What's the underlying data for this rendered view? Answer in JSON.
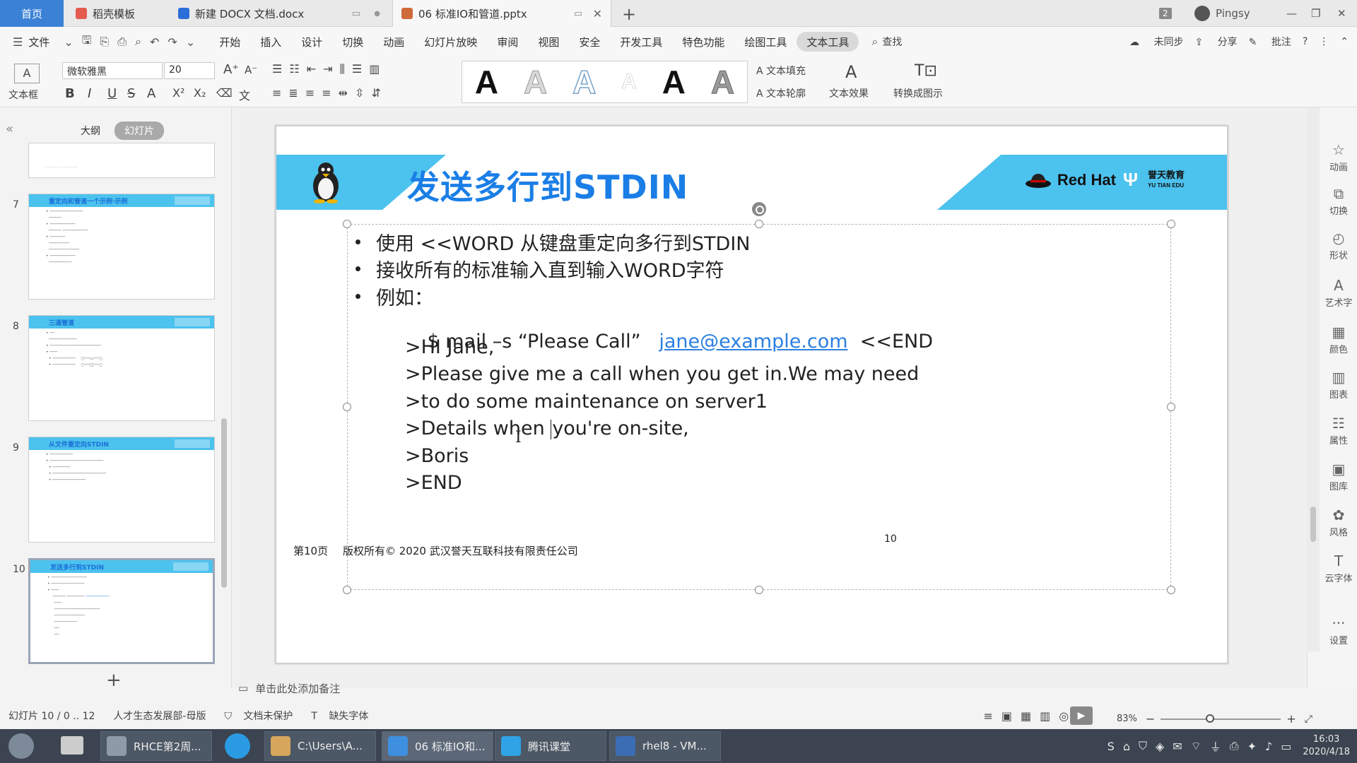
{
  "tabs": {
    "home": "首页",
    "items": [
      {
        "label": "稻壳模板",
        "icon": "docer-icon",
        "color": "#e35a4e"
      },
      {
        "label": "新建 DOCX 文档.docx",
        "icon": "word-doc-icon",
        "color": "#2b6ed8"
      },
      {
        "label": "06 标准IO和管道.pptx",
        "icon": "ppt-doc-icon",
        "color": "#cf6a3a"
      }
    ],
    "user": "Pingsy",
    "badge": "2"
  },
  "menu": {
    "file": "文件",
    "items": [
      "开始",
      "插入",
      "设计",
      "切换",
      "动画",
      "幻灯片放映",
      "审阅",
      "视图",
      "安全",
      "开发工具",
      "特色功能",
      "绘图工具",
      "文本工具"
    ],
    "active": "文本工具",
    "search": "查找",
    "sync": "未同步",
    "share": "分享",
    "comment": "批注"
  },
  "ribbon": {
    "textbox_label": "文本框",
    "font_name": "微软雅黑",
    "font_size": "20",
    "text_fill": "文本填充",
    "text_outline": "文本轮廓",
    "text_effect": "文本效果",
    "to_smartart": "转换成图示",
    "gallery": [
      "A",
      "A",
      "A",
      "A",
      "A",
      "A"
    ]
  },
  "left_pane": {
    "tab_outline": "大纲",
    "tab_slides": "幻灯片",
    "thumbs": [
      {
        "num": "7",
        "title": "重定向和管道一个示例·示例"
      },
      {
        "num": "8",
        "title": "三通管道"
      },
      {
        "num": "9",
        "title": "从文件重定向STDIN"
      },
      {
        "num": "10",
        "title": "发送多行到STDIN"
      }
    ]
  },
  "slide": {
    "title": "发送多行到STDIN",
    "logo_text": "Red Hat",
    "logo_cn": "誉天教育",
    "logo_en": "YU TIAN EDU",
    "bullets": [
      "使用 <<WORD 从键盘重定向多行到STDIN",
      "接收所有的标准输入直到输入WORD字符",
      "例如："
    ],
    "cmd_prefix": "$ mail –s “Please Call”",
    "cmd_email": "jane@example.com",
    "cmd_suffix": "<<END",
    "lines": [
      ">HI Jane,",
      ">Please give me a call when you get in.We may need",
      ">to do some maintenance on server1",
      ">Details when you're on-site,",
      ">Boris",
      ">END"
    ],
    "line4_a": ">Details when ",
    "line4_b": "you're on-site,",
    "footer_page": "第10页",
    "footer_copy": "版权所有© 2020 武汉誉天互联科技有限责任公司",
    "page_number": "10"
  },
  "right_tools": [
    "动画",
    "切换",
    "形状",
    "艺术字",
    "颜色",
    "图表",
    "属性",
    "图库",
    "风格",
    "云字体",
    "设置"
  ],
  "notes_placeholder": "单击此处添加备注",
  "status": {
    "slide_info": "幻灯片 10 / 0 .. 12",
    "template": "人才生态发展部-母版",
    "protect": "文档未保护",
    "missing_font": "缺失字体",
    "zoom": "83%"
  },
  "taskbar": {
    "items": [
      {
        "label": "RHCE第2周...",
        "color": "#8e9aa8"
      },
      {
        "label": "C:\\Users\\A...",
        "color": "#d6a65c"
      },
      {
        "label": "06 标准IO和...",
        "color": "#3f8fe0"
      },
      {
        "label": "腾讯课堂",
        "color": "#2fa3e6"
      },
      {
        "label": "rhel8 - VM...",
        "color": "#3b6db5"
      }
    ],
    "time": "16:03",
    "date": "2020/4/18"
  }
}
